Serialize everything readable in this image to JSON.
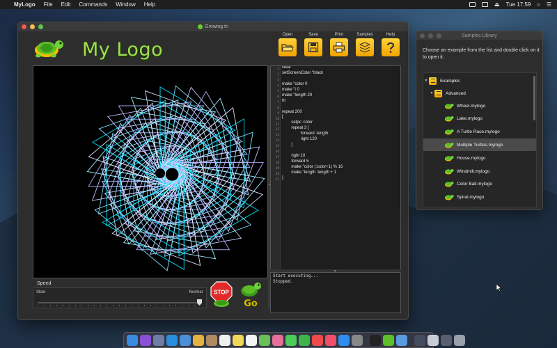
{
  "menubar": {
    "app_name": "MyLogo",
    "items": [
      "File",
      "Edit",
      "Commands",
      "Window",
      "Help"
    ],
    "clock": "Tue 17:59"
  },
  "window": {
    "title": "Growing tri",
    "logo_text": "My Logo",
    "toolbar": [
      {
        "label": "Open",
        "icon": "folder-open-icon"
      },
      {
        "label": "Save",
        "icon": "floppy-disk-icon"
      },
      {
        "label": "Print",
        "icon": "printer-icon"
      },
      {
        "label": "Samples",
        "icon": "samples-stack-icon"
      },
      {
        "label": "Help",
        "icon": "question-mark-icon"
      }
    ],
    "speed": {
      "title": "Speed",
      "slow_label": "Slow",
      "normal_label": "Normal",
      "value_fraction": 1.0
    },
    "stop_label": "STOP",
    "go_label": "Go",
    "code_lines": [
      "clear",
      "setScreenColor \"black",
      "",
      "make \"color 0",
      "make \"i 0",
      "make \"length 20",
      "ht",
      "",
      "repeat 200",
      "[",
      "        setpc :color",
      "        repeat 3 [",
      "                forward :length",
      "                right 120",
      "        ]",
      "",
      "        right 10",
      "        forward 5",
      "        make \"color (:color+1) % 16",
      "        make \"length :length + 1",
      "]"
    ],
    "console_lines": [
      "Start executing...",
      "Stopped."
    ]
  },
  "library": {
    "title": "Samples Library",
    "description": "Choose an example from the list and double click on it to open it.",
    "root": "Examples",
    "folder": "Advanced",
    "files": [
      "Wheel.mylogo",
      "Lake.mylogo",
      "A Turtle Race.mylogo",
      "Multiple Turtles.mylogo",
      "House.mylogo",
      "Windmill.mylogo",
      "Color Ball.mylogo",
      "Spiral.mylogo"
    ],
    "selected_file": "Multiple Turtles.mylogo"
  },
  "colors": {
    "accent_yellow": "#f2a400",
    "logo_green": "#9fe14a",
    "canvas_bg": "#000000",
    "stroke_palette": [
      "#00e5ff",
      "#7fdfff",
      "#c8c8ff",
      "#b0b0ff",
      "#a0f0ff",
      "#e0e0ff"
    ]
  }
}
